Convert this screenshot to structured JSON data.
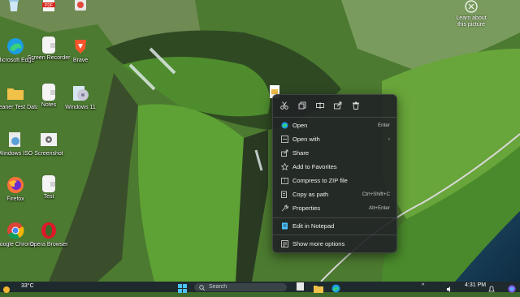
{
  "desktop": {
    "icons": [
      {
        "label": "",
        "icon": "recycle-bin-icon"
      },
      {
        "label": "",
        "icon": "pdf-icon"
      },
      {
        "label": "",
        "icon": "app-icon"
      },
      {
        "label": "Microsoft Edge",
        "icon": "edge-icon"
      },
      {
        "label": "Screen Recorder",
        "icon": "file-icon"
      },
      {
        "label": "Brave",
        "icon": "brave-icon"
      },
      {
        "label": "Cleaner Test Data",
        "icon": "folder-icon"
      },
      {
        "label": "Notes",
        "icon": "file-icon"
      },
      {
        "label": "Windows 11",
        "icon": "disc-icon"
      },
      {
        "label": "Windows ISO",
        "icon": "iso-icon"
      },
      {
        "label": "Screenshot",
        "icon": "settings-file-icon"
      },
      {
        "label": "Firefox",
        "icon": "firefox-icon"
      },
      {
        "label": "Test",
        "icon": "file-icon"
      },
      {
        "label": "Google Chrome",
        "icon": "chrome-icon"
      },
      {
        "label": "Opera Browser",
        "icon": "opera-icon"
      }
    ],
    "learn_about": "Learn about this picture"
  },
  "context_menu": {
    "toolbar": [
      "cut-icon",
      "copy-icon",
      "rename-icon",
      "share-icon",
      "delete-icon"
    ],
    "items": [
      {
        "label": "Open",
        "shortcut": "Enter",
        "icon": "open-icon"
      },
      {
        "label": "Open with",
        "shortcut": "",
        "icon": "open-with-icon",
        "submenu": true
      },
      {
        "label": "Share",
        "shortcut": "",
        "icon": "share-icon"
      },
      {
        "label": "Add to Favorites",
        "shortcut": "",
        "icon": "star-icon"
      },
      {
        "label": "Compress to ZIP file",
        "shortcut": "",
        "icon": "zip-icon"
      },
      {
        "label": "Copy as path",
        "shortcut": "Ctrl+Shift+C",
        "icon": "path-icon"
      },
      {
        "label": "Properties",
        "shortcut": "Alt+Enter",
        "icon": "wrench-icon"
      },
      {
        "label": "Edit in Notepad",
        "shortcut": "",
        "icon": "notepad-icon"
      },
      {
        "label": "Show more options",
        "shortcut": "",
        "icon": "more-options-icon"
      }
    ],
    "submenu_arrow": "›"
  },
  "taskbar": {
    "weather": "33°C",
    "search_placeholder": "Search",
    "time": "4:31 PM",
    "arrow": "^"
  },
  "colors": {
    "accent": "#4cc2ff",
    "menu_bg": "#212426",
    "taskbar_bg": "#1f2a2e"
  }
}
